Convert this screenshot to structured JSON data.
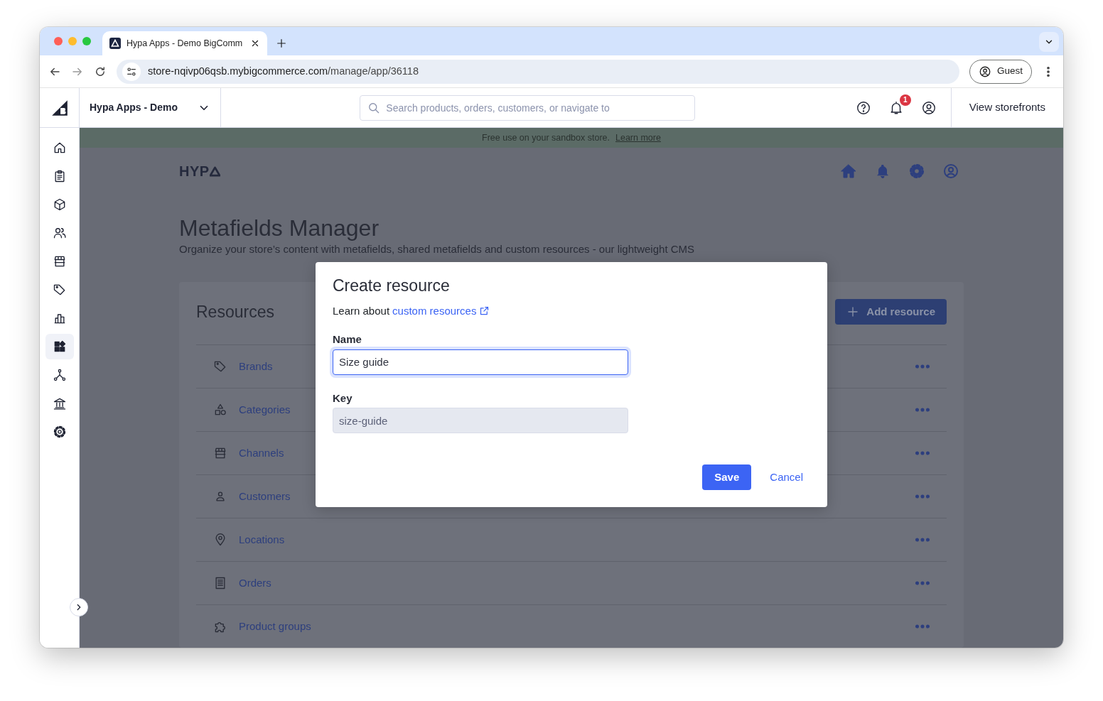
{
  "browser": {
    "tab_title": "Hypa Apps - Demo BigComm",
    "url_host": "store-nqivp06qsb.mybigcommerce.com",
    "url_path": "/manage/app/36118",
    "profile": "Guest"
  },
  "app_header": {
    "store_name": "Hypa Apps - Demo",
    "search": {
      "placeholder": "Search products, orders, customers, or navigate to"
    },
    "notification_count": "1",
    "view_storefronts": "View storefronts"
  },
  "sidebar": {
    "items": [
      {
        "kind": "home",
        "selected": false
      },
      {
        "kind": "clipboard",
        "selected": false
      },
      {
        "kind": "cube",
        "selected": false
      },
      {
        "kind": "people",
        "selected": false
      },
      {
        "kind": "store",
        "selected": false
      },
      {
        "kind": "tag",
        "selected": false
      },
      {
        "kind": "chart",
        "selected": false
      },
      {
        "kind": "apps",
        "selected": true
      },
      {
        "kind": "network",
        "selected": false
      },
      {
        "kind": "bank",
        "selected": false
      },
      {
        "kind": "gear",
        "selected": false
      }
    ]
  },
  "banner": {
    "text": "Free use on your sandbox store.",
    "link": "Learn more"
  },
  "app": {
    "logo": "HYP",
    "title": "Metafields Manager",
    "subtitle": "Organize your store’s content with metafields, shared metafields and custom resources - our lightweight CMS",
    "resources": {
      "title": "Resources",
      "add_button": "Add resource",
      "rows": [
        {
          "kind": "tag",
          "label": "Brands"
        },
        {
          "kind": "shapes",
          "label": "Categories"
        },
        {
          "kind": "store",
          "label": "Channels"
        },
        {
          "kind": "person",
          "label": "Customers"
        },
        {
          "kind": "pin",
          "label": "Locations"
        },
        {
          "kind": "receipt",
          "label": "Orders"
        },
        {
          "kind": "puzzle",
          "label": "Product groups"
        }
      ]
    }
  },
  "modal": {
    "title": "Create resource",
    "intro": "Learn about",
    "link": "custom resources",
    "fields": [
      {
        "label": "Name",
        "value": "Size guide",
        "focused": true,
        "disabled": false
      },
      {
        "label": "Key",
        "value": "size-guide",
        "focused": false,
        "disabled": true
      }
    ],
    "save": "Save",
    "cancel": "Cancel"
  }
}
